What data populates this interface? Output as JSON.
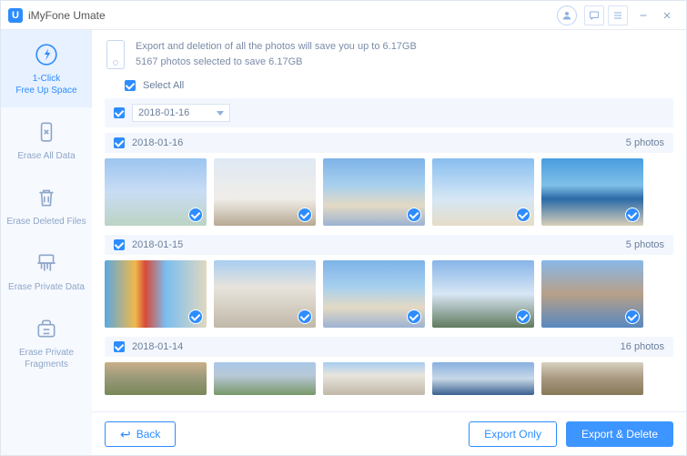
{
  "app": {
    "title": "iMyFone Umate"
  },
  "sidebar": {
    "items": [
      {
        "label": "1-Click\nFree Up Space"
      },
      {
        "label": "Erase All Data"
      },
      {
        "label": "Erase Deleted Files"
      },
      {
        "label": "Erase Private Data"
      },
      {
        "label": "Erase Private\nFragments"
      }
    ]
  },
  "info": {
    "line1_prefix": "Export and deletion of all the photos will save you up to ",
    "line1_size": "6.17GB",
    "line2_count": "5167",
    "line2_mid": " photos selected to save ",
    "line2_size": "6.17GB"
  },
  "selectall": {
    "label": "Select All"
  },
  "dropdown": {
    "value": "2018-01-16"
  },
  "groups": [
    {
      "date": "2018-01-16",
      "count": "5 photos"
    },
    {
      "date": "2018-01-15",
      "count": "5 photos"
    },
    {
      "date": "2018-01-14",
      "count": "16 photos"
    }
  ],
  "footer": {
    "back": "Back",
    "export_only": "Export Only",
    "export_delete": "Export & Delete"
  }
}
